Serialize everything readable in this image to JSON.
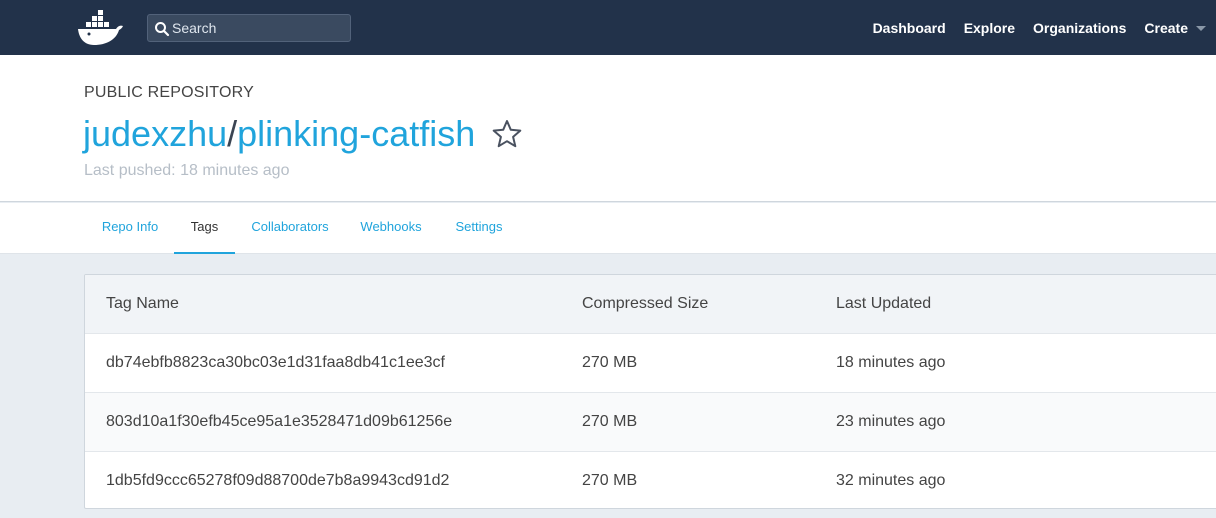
{
  "nav": {
    "search_placeholder": "Search",
    "items": [
      "Dashboard",
      "Explore",
      "Organizations",
      "Create"
    ]
  },
  "repo": {
    "type_label": "PUBLIC REPOSITORY",
    "namespace": "judexzhu",
    "separator": "/",
    "name": "plinking-catfish",
    "last_pushed": "Last pushed: 18 minutes ago"
  },
  "tabs": [
    "Repo Info",
    "Tags",
    "Collaborators",
    "Webhooks",
    "Settings"
  ],
  "active_tab": "Tags",
  "table": {
    "headers": [
      "Tag Name",
      "Compressed Size",
      "Last Updated"
    ],
    "rows": [
      [
        "db74ebfb8823ca30bc03e1d31faa8db41c1ee3cf",
        "270 MB",
        "18 minutes ago"
      ],
      [
        "803d10a1f30efb45ce95a1e3528471d09b61256e",
        "270 MB",
        "23 minutes ago"
      ],
      [
        "1db5fd9ccc65278f09d88700de7b8a9943cd91d2",
        "270 MB",
        "32 minutes ago"
      ]
    ]
  },
  "colors": {
    "navbar": "#22324a",
    "link": "#20a4dc",
    "page_bg": "#e8edf2"
  },
  "icons": [
    "docker-whale-logo",
    "search-icon",
    "star-outline-icon",
    "caret-down-icon"
  ]
}
